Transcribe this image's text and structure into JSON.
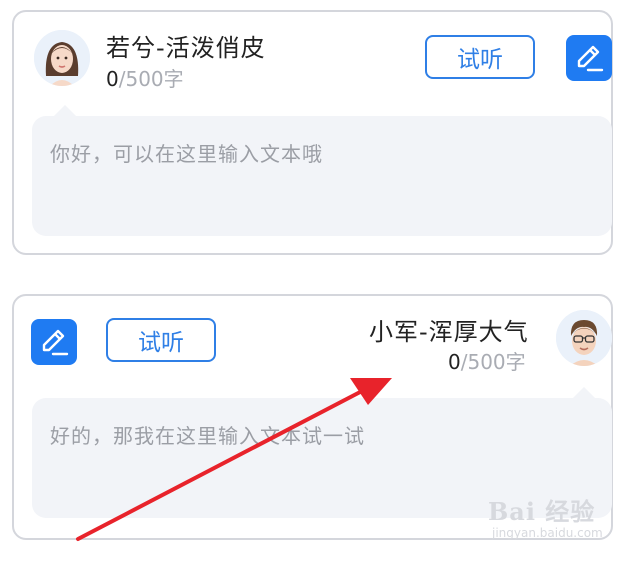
{
  "voices": [
    {
      "name": "若兮-活泼俏皮",
      "count_current": "0",
      "count_limit": "/500字",
      "listen_label": "试听",
      "placeholder": "你好，可以在这里输入文本哦",
      "avatar": "female-avatar-icon",
      "edit_icon": "pencil-icon"
    },
    {
      "name": "小军-浑厚大气",
      "count_current": "0",
      "count_limit": "/500字",
      "listen_label": "试听",
      "placeholder": "好的，那我在这里输入文本试一试",
      "avatar": "male-avatar-icon",
      "edit_icon": "pencil-icon"
    }
  ],
  "watermark": {
    "main": "Bai 经验",
    "sub": "jingyan.baidu.com"
  },
  "colors": {
    "accent": "#1f7bf2",
    "arrow": "#e8232b",
    "card_border": "#d4d6dc",
    "textarea_bg": "#f2f4f8"
  }
}
